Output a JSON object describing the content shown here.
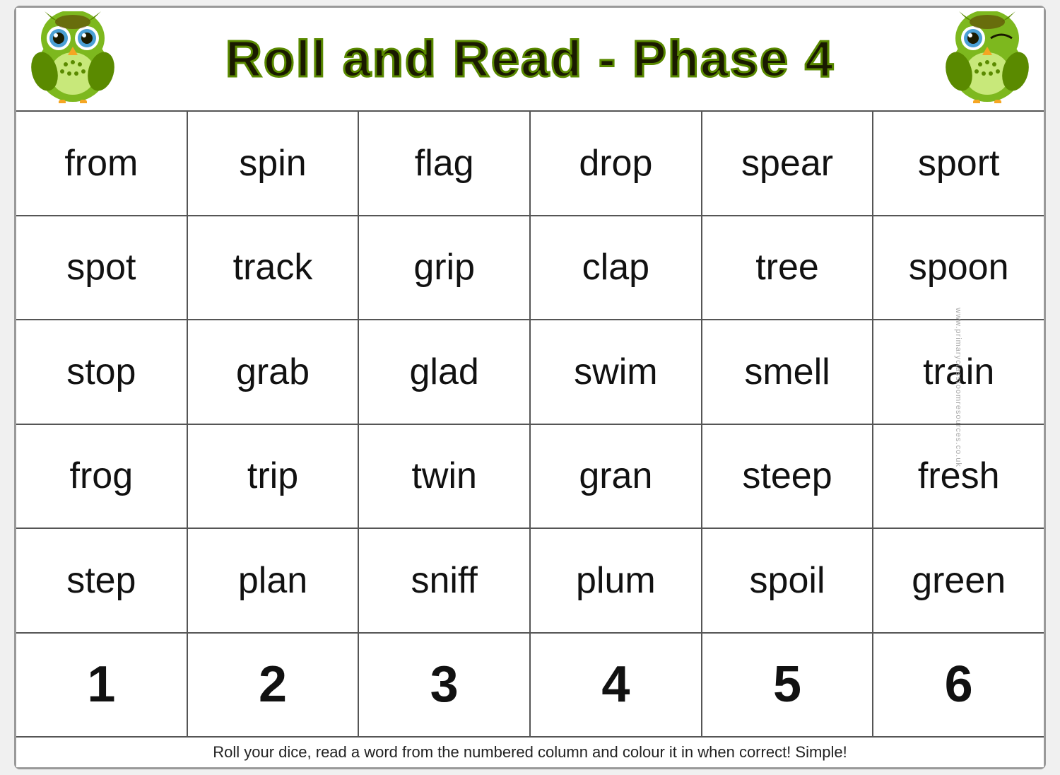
{
  "header": {
    "title": "Roll and Read - Phase 4"
  },
  "grid": {
    "rows": [
      [
        "from",
        "spin",
        "flag",
        "drop",
        "spear",
        "sport"
      ],
      [
        "spot",
        "track",
        "grip",
        "clap",
        "tree",
        "spoon"
      ],
      [
        "stop",
        "grab",
        "glad",
        "swim",
        "smell",
        "train"
      ],
      [
        "frog",
        "trip",
        "twin",
        "gran",
        "steep",
        "fresh"
      ],
      [
        "step",
        "plan",
        "sniff",
        "plum",
        "spoil",
        "green"
      ],
      [
        "1",
        "2",
        "3",
        "4",
        "5",
        "6"
      ]
    ],
    "number_row_index": 5
  },
  "footer": {
    "text": "Roll your dice, read a word from the numbered column and colour it in when correct!  Simple!"
  },
  "watermark": {
    "text": "www.primaryclassroomresources.co.uk"
  }
}
